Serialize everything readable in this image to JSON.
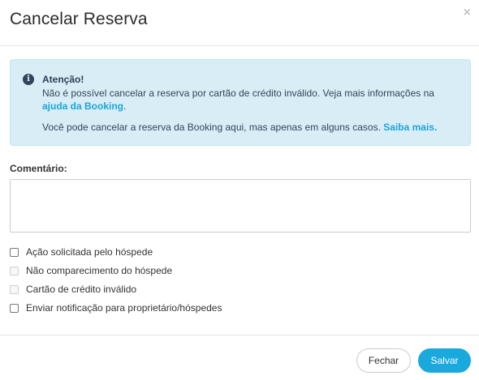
{
  "modal": {
    "title": "Cancelar Reserva",
    "close_glyph": "×"
  },
  "alert": {
    "icon": "info-icon",
    "icon_glyph": "i",
    "heading": "Atenção!",
    "line1_text": "Não é possível cancelar a reserva por cartão de crédito inválido. Veja mais informações na",
    "line2_link": "ajuda da Booking",
    "line2_suffix": ".",
    "line3_text": "Você pode cancelar a reserva da Booking aqui, mas apenas em alguns casos.",
    "line3_link": "Saiba mais.",
    "colors": {
      "background": "#d9edf7",
      "link": "#1ba5d8"
    }
  },
  "comment": {
    "label": "Comentário:",
    "value": ""
  },
  "options": [
    {
      "label": "Ação solicitada pelo hóspede",
      "checked": false,
      "disabled": false
    },
    {
      "label": "Não comparecimento do hóspede",
      "checked": false,
      "disabled": true
    },
    {
      "label": "Cartão de crédito inválido",
      "checked": false,
      "disabled": true
    },
    {
      "label": "Enviar notificação para proprietário/hóspedes",
      "checked": false,
      "disabled": false
    }
  ],
  "footer": {
    "close_label": "Fechar",
    "save_label": "Salvar",
    "save_color": "#1aa9dd"
  }
}
